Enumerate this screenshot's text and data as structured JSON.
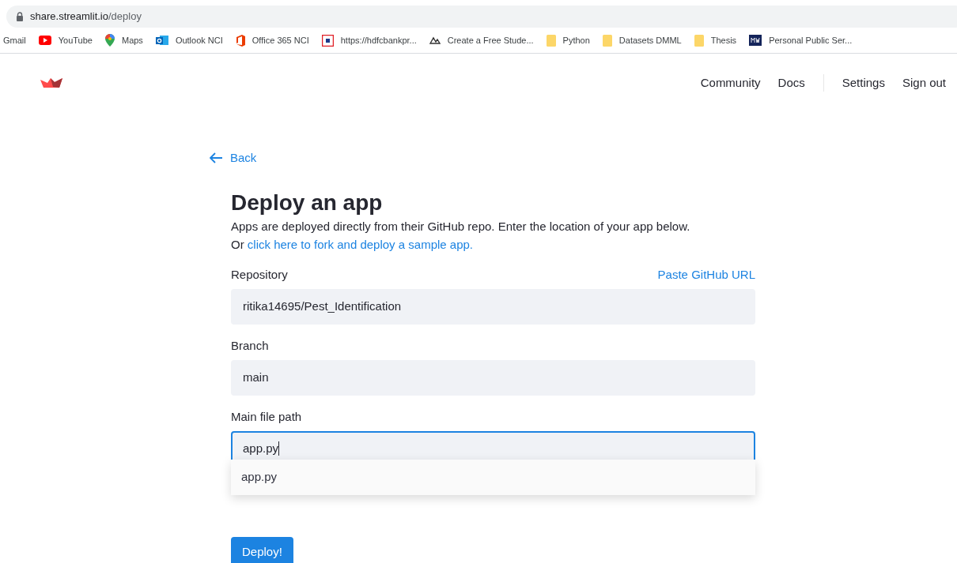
{
  "browser": {
    "url_host": "share.streamlit.io",
    "url_path": "/deploy"
  },
  "bookmarks": [
    {
      "kind": "none",
      "label": "Gmail"
    },
    {
      "kind": "youtube",
      "label": "YouTube"
    },
    {
      "kind": "maps",
      "label": "Maps"
    },
    {
      "kind": "outlook",
      "label": "Outlook NCI"
    },
    {
      "kind": "office",
      "label": "Office 365 NCI"
    },
    {
      "kind": "bank",
      "label": "https://hdfcbankpr..."
    },
    {
      "kind": "mountain",
      "label": "Create a Free Stude..."
    },
    {
      "kind": "folder",
      "label": "Python"
    },
    {
      "kind": "folder",
      "label": "Datasets DMML"
    },
    {
      "kind": "folder",
      "label": "Thesis"
    },
    {
      "kind": "mw",
      "label": "Personal Public Ser..."
    }
  ],
  "nav": {
    "links": [
      "Community",
      "Docs"
    ],
    "account": [
      "Settings",
      "Sign out"
    ]
  },
  "back": "Back",
  "title": "Deploy an app",
  "intro": "Apps are deployed directly from their GitHub repo. Enter the location of your app below.",
  "intro2_prefix": "Or",
  "intro2_link": "click here to fork and deploy a sample app.",
  "paste_link": "Paste GitHub URL",
  "fields": [
    {
      "label": "Repository",
      "value": "ritika14695/Pest_Identification",
      "focused": false
    },
    {
      "label": "Branch",
      "value": "main",
      "focused": false
    },
    {
      "label": "Main file path",
      "value": "app.py",
      "focused": true
    }
  ],
  "suggestions": [
    "app.py"
  ],
  "deploy_button": "Deploy!"
}
